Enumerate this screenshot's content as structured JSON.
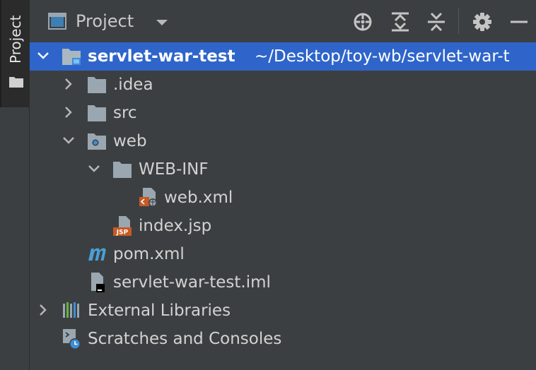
{
  "side_tab": {
    "label": "Project"
  },
  "header": {
    "title": "Project"
  },
  "tree": {
    "root": {
      "label": "servlet-war-test",
      "path": "~/Desktop/toy-wb/servlet-war-t"
    },
    "items": [
      {
        "label": ".idea"
      },
      {
        "label": "src"
      },
      {
        "label": "web"
      },
      {
        "label": "WEB-INF"
      },
      {
        "label": "web.xml"
      },
      {
        "label": "index.jsp"
      },
      {
        "label": "pom.xml"
      },
      {
        "label": "servlet-war-test.iml"
      },
      {
        "label": "External Libraries"
      },
      {
        "label": "Scratches and Consoles"
      }
    ]
  },
  "colors": {
    "panel_bg": "#3c3f41",
    "selection": "#2f65ca",
    "folder": "#9aa7b0",
    "text": "#d2d2d2"
  }
}
